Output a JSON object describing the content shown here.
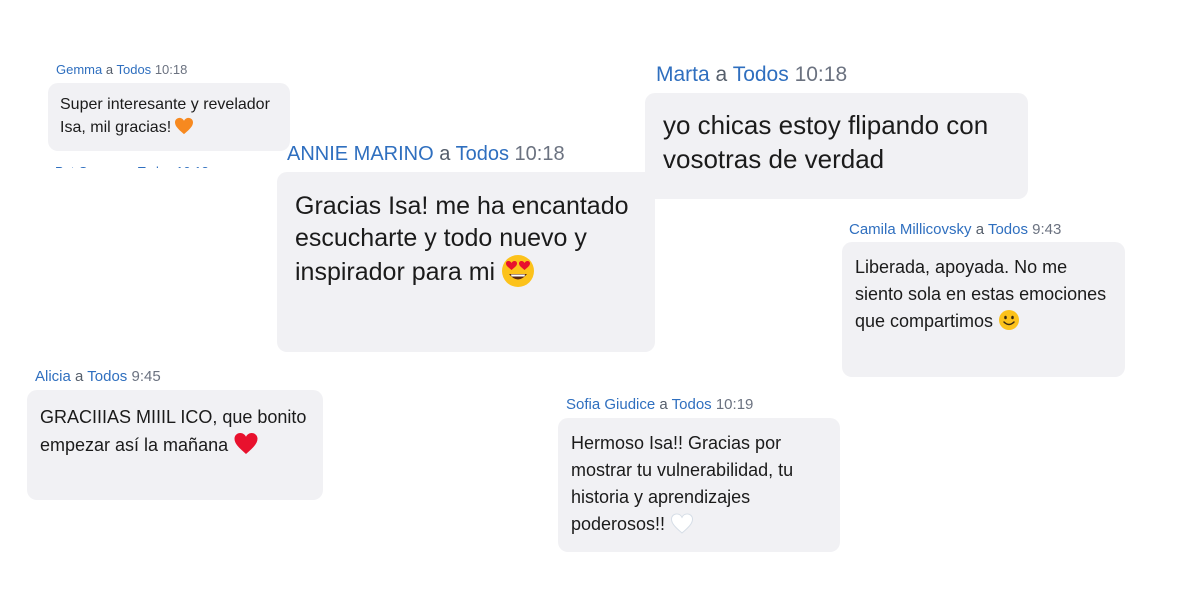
{
  "messages": {
    "gemma": {
      "sender": "Gemma",
      "to": "a",
      "audience": "Todos",
      "time": "10:18",
      "text": "Super interesante y revelador Isa, mil gracias!",
      "emoji": "orange-heart"
    },
    "annie": {
      "sender": "ANNIE MARINO",
      "to": "a",
      "audience": "Todos",
      "time": "10:18",
      "text": "Gracias Isa! me ha encantado escucharte y todo nuevo y inspirador para mi",
      "emoji": "heart-eyes"
    },
    "marta": {
      "sender": "Marta",
      "to": "a",
      "audience": "Todos",
      "time": "10:18",
      "text": "yo chicas estoy flipando con vosotras de verdad"
    },
    "camila": {
      "sender": "Camila Millicovsky",
      "to": "a",
      "audience": "Todos",
      "time": "9:43",
      "text": "Liberada, apoyada. No me siento sola en estas emociones que compartimos",
      "emoji": "smile"
    },
    "alicia": {
      "sender": "Alicia",
      "to": "a",
      "audience": "Todos",
      "time": "9:45",
      "text": "GRACIIIAS MIIIL ICO, que bonito empezar así la mañana",
      "emoji": "red-heart"
    },
    "sofia": {
      "sender": "Sofia Giudice",
      "to": "a",
      "audience": "Todos",
      "time": "10:19",
      "text": "Hermoso Isa!! Gracias por mostrar tu vulnerabilidad, tu historia y aprendizajes poderosos!!",
      "emoji": "white-heart"
    }
  },
  "colors": {
    "sender": "#2f6fbf",
    "bubble": "#f1f1f4",
    "text": "#1b1b1b",
    "time": "#6b7280"
  }
}
